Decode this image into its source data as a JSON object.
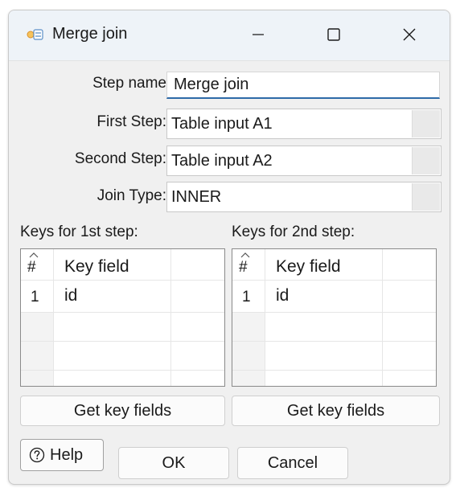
{
  "window": {
    "title": "Merge join",
    "controls": {
      "minimize": "—",
      "maximize": "☐",
      "close": "✕"
    }
  },
  "form": {
    "step_name": {
      "label": "Step name",
      "value": "Merge join"
    },
    "first_step": {
      "label": "First Step:",
      "value": "Table input A1"
    },
    "second_step": {
      "label": "Second Step:",
      "value": "Table input A2"
    },
    "join_type": {
      "label": "Join Type:",
      "value": "INNER"
    }
  },
  "keys1": {
    "label": "Keys for 1st step:",
    "columns": [
      "#",
      "Key field"
    ],
    "rows": [
      {
        "num": "1",
        "field": "id"
      }
    ],
    "button": "Get key fields"
  },
  "keys2": {
    "label": "Keys for 2nd step:",
    "columns": [
      "#",
      "Key field"
    ],
    "rows": [
      {
        "num": "1",
        "field": "id"
      }
    ],
    "button": "Get key fields"
  },
  "footer": {
    "help": "Help",
    "ok": "OK",
    "cancel": "Cancel"
  },
  "colors": {
    "accent_underline": "#2e6aa8",
    "dialog_bg": "#f0f0f0",
    "titlebar_bg": "#eef3f8"
  },
  "icons": {
    "app": "merge-join-icon",
    "help": "question-circle-icon",
    "sort": "sort-up-icon"
  }
}
